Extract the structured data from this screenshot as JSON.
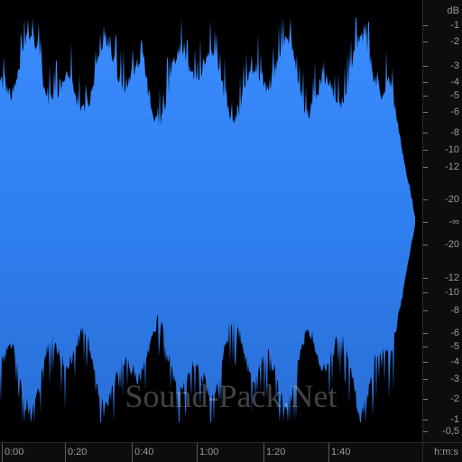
{
  "waveform": {
    "fill_color": "#3a86f0",
    "fill_color_dark": "#2060c0",
    "background": "#000000"
  },
  "db_scale": {
    "unit": "dB",
    "labels": [
      "-1",
      "-2",
      "-3",
      "-4",
      "-5",
      "-6",
      "-8",
      "-10",
      "-12",
      "-20",
      "-∞",
      "-20",
      "-12",
      "-10",
      "-8",
      "-6",
      "-5",
      "-4",
      "-3",
      "-2",
      "-1",
      "-0,5"
    ]
  },
  "time_scale": {
    "unit": "h:m:s",
    "labels": [
      "0:00",
      "0:20",
      "0:40",
      "1:00",
      "1:20",
      "1:40"
    ]
  },
  "watermark": "Sound-Pack.Net"
}
